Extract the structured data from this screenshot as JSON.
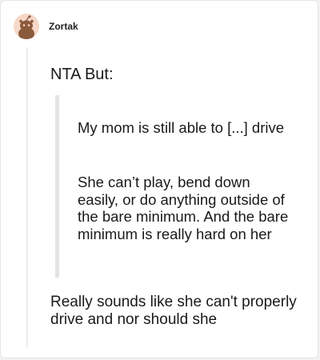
{
  "comment": {
    "author": "Zortak",
    "opening": "NTA But:",
    "quote": {
      "paragraph_1": "My mom is still able to [...] drive",
      "paragraph_2": "She can’t play, bend down easily, or do anything outside of the bare minimum. And the bare minimum is really hard on her"
    },
    "reply": "Really sounds like she can't properly drive and nor should she"
  },
  "colors": {
    "background": "#f2f2f2",
    "card": "#ffffff",
    "avatar_bg": "#f6d8c8",
    "avatar_figure": "#8a5a3c",
    "quote_bar": "#e3e3e3",
    "thread_line": "#ececec",
    "text": "#1a1a1a"
  },
  "icons": {
    "avatar": "reddit-snoo-avatar-icon"
  }
}
